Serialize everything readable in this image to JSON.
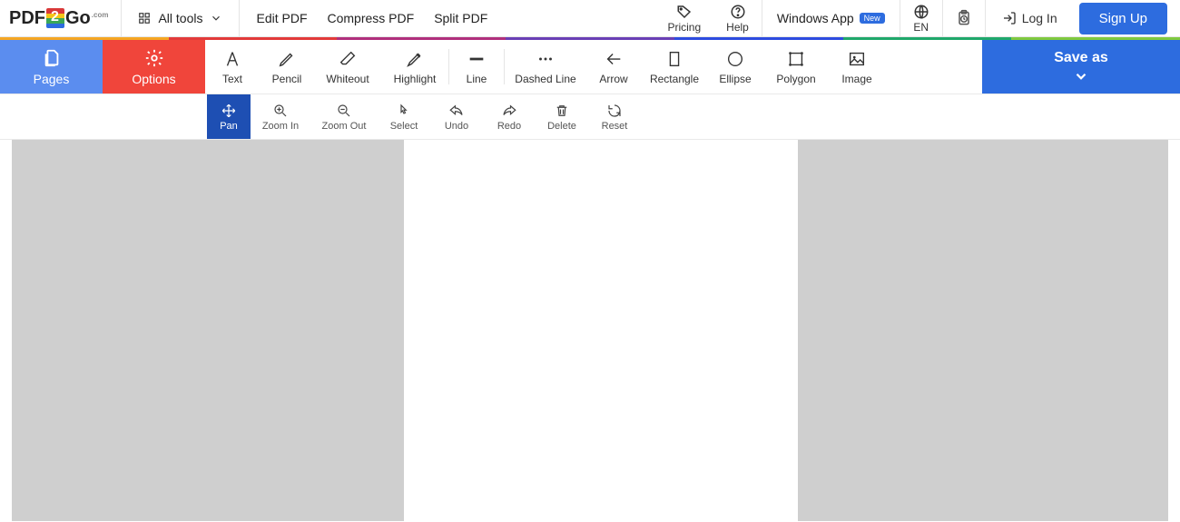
{
  "header": {
    "logo_left": "PDF",
    "logo_right": "Go",
    "logo_suffix": ".com",
    "all_tools": "All tools",
    "links": [
      "Edit PDF",
      "Compress PDF",
      "Split PDF"
    ],
    "pricing": "Pricing",
    "help": "Help",
    "windows_app": "Windows App",
    "new_badge": "New",
    "lang": "EN",
    "login": "Log In",
    "signup": "Sign Up"
  },
  "sidebuttons": {
    "pages": "Pages",
    "options": "Options"
  },
  "tools": {
    "text": "Text",
    "pencil": "Pencil",
    "whiteout": "Whiteout",
    "highlight": "Highlight",
    "line": "Line",
    "dashed": "Dashed Line",
    "arrow": "Arrow",
    "rectangle": "Rectangle",
    "ellipse": "Ellipse",
    "polygon": "Polygon",
    "image": "Image"
  },
  "saveas": "Save as",
  "subtools": {
    "pan": "Pan",
    "zoomin": "Zoom In",
    "zoomout": "Zoom Out",
    "select": "Select",
    "undo": "Undo",
    "redo": "Redo",
    "delete": "Delete",
    "reset": "Reset"
  }
}
